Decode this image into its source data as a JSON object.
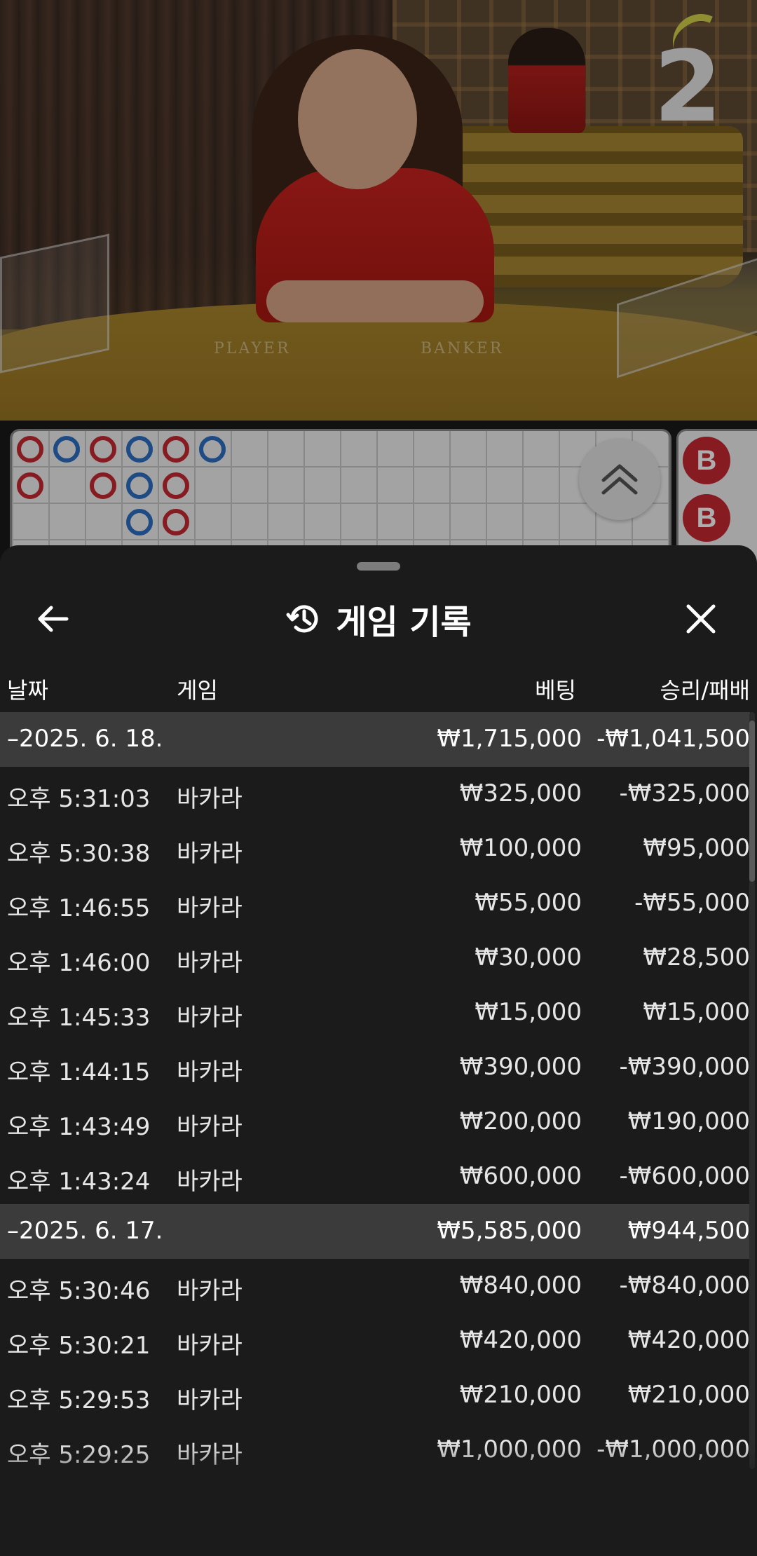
{
  "video": {
    "round_number": "2",
    "table_labels": {
      "player": "PLAYER",
      "banker": "BANKER"
    }
  },
  "roadmap": {
    "big_road": [
      {
        "col": 0,
        "row": 0,
        "color": "red"
      },
      {
        "col": 0,
        "row": 1,
        "color": "red"
      },
      {
        "col": 1,
        "row": 0,
        "color": "blue"
      },
      {
        "col": 2,
        "row": 0,
        "color": "red"
      },
      {
        "col": 2,
        "row": 1,
        "color": "red"
      },
      {
        "col": 3,
        "row": 0,
        "color": "blue"
      },
      {
        "col": 3,
        "row": 1,
        "color": "blue"
      },
      {
        "col": 3,
        "row": 2,
        "color": "blue"
      },
      {
        "col": 4,
        "row": 0,
        "color": "red"
      },
      {
        "col": 4,
        "row": 1,
        "color": "red"
      },
      {
        "col": 4,
        "row": 2,
        "color": "red"
      },
      {
        "col": 5,
        "row": 0,
        "color": "blue"
      }
    ],
    "bead_road": [
      {
        "label": "B",
        "type": "banker"
      },
      {
        "label": "B",
        "type": "banker"
      }
    ]
  },
  "sheet": {
    "title": "게임 기록",
    "icons": {
      "back": "arrow-left-icon",
      "history": "history-icon",
      "close": "close-icon"
    },
    "columns": {
      "date": "날짜",
      "game": "게임",
      "bet": "베팅",
      "result": "승리/패배"
    },
    "groups": [
      {
        "date": "–2025. 6. 18.",
        "total_bet": "₩1,715,000",
        "total_result": "-₩1,041,500",
        "rows": [
          {
            "time": "오후 5:31:03",
            "game": "바카라",
            "bet": "₩325,000",
            "result": "-₩325,000"
          },
          {
            "time": "오후 5:30:38",
            "game": "바카라",
            "bet": "₩100,000",
            "result": "₩95,000"
          },
          {
            "time": "오후 1:46:55",
            "game": "바카라",
            "bet": "₩55,000",
            "result": "-₩55,000"
          },
          {
            "time": "오후 1:46:00",
            "game": "바카라",
            "bet": "₩30,000",
            "result": "₩28,500"
          },
          {
            "time": "오후 1:45:33",
            "game": "바카라",
            "bet": "₩15,000",
            "result": "₩15,000"
          },
          {
            "time": "오후 1:44:15",
            "game": "바카라",
            "bet": "₩390,000",
            "result": "-₩390,000"
          },
          {
            "time": "오후 1:43:49",
            "game": "바카라",
            "bet": "₩200,000",
            "result": "₩190,000"
          },
          {
            "time": "오후 1:43:24",
            "game": "바카라",
            "bet": "₩600,000",
            "result": "-₩600,000"
          }
        ]
      },
      {
        "date": "–2025. 6. 17.",
        "total_bet": "₩5,585,000",
        "total_result": "₩944,500",
        "rows": [
          {
            "time": "오후 5:30:46",
            "game": "바카라",
            "bet": "₩840,000",
            "result": "-₩840,000"
          },
          {
            "time": "오후 5:30:21",
            "game": "바카라",
            "bet": "₩420,000",
            "result": "₩420,000"
          },
          {
            "time": "오후 5:29:53",
            "game": "바카라",
            "bet": "₩210,000",
            "result": "₩210,000"
          },
          {
            "time": "오후 5:29:25",
            "game": "바카라",
            "bet": "₩1,000,000",
            "result": "-₩1,000,000"
          }
        ]
      }
    ]
  }
}
